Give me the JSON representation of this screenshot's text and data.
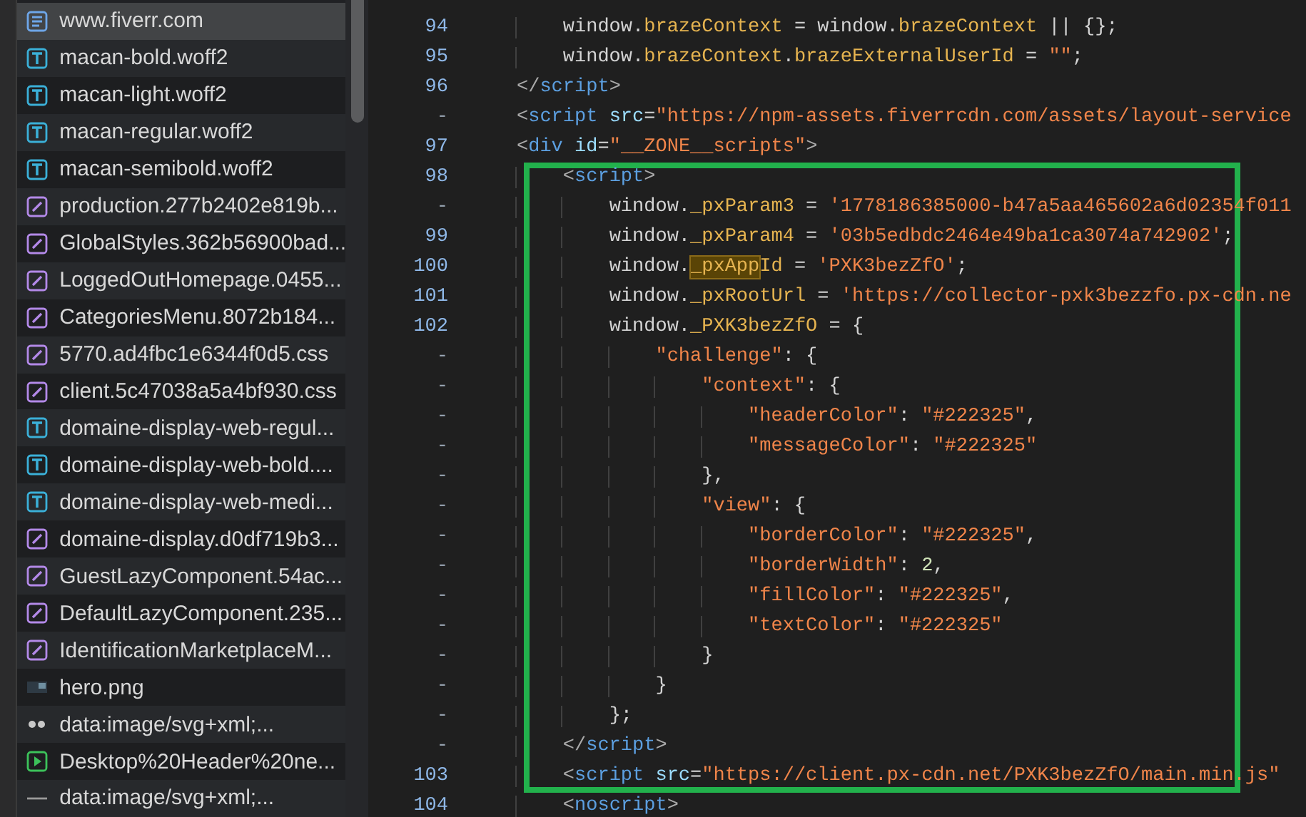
{
  "files": [
    {
      "name": "www.fiverr.com",
      "kind": "document",
      "selected": true
    },
    {
      "name": "macan-bold.woff2",
      "kind": "font",
      "selected": false
    },
    {
      "name": "macan-light.woff2",
      "kind": "font",
      "selected": false
    },
    {
      "name": "macan-regular.woff2",
      "kind": "font",
      "selected": false
    },
    {
      "name": "macan-semibold.woff2",
      "kind": "font",
      "selected": false
    },
    {
      "name": "production.277b2402e819b...",
      "kind": "stylesheet",
      "selected": false
    },
    {
      "name": "GlobalStyles.362b56900bad...",
      "kind": "stylesheet",
      "selected": false
    },
    {
      "name": "LoggedOutHomepage.0455...",
      "kind": "stylesheet",
      "selected": false
    },
    {
      "name": "CategoriesMenu.8072b184...",
      "kind": "stylesheet",
      "selected": false
    },
    {
      "name": "5770.ad4fbc1e6344f0d5.css",
      "kind": "stylesheet",
      "selected": false
    },
    {
      "name": "client.5c47038a5a4bf930.css",
      "kind": "stylesheet",
      "selected": false
    },
    {
      "name": "domaine-display-web-regul...",
      "kind": "font",
      "selected": false
    },
    {
      "name": "domaine-display-web-bold....",
      "kind": "font",
      "selected": false
    },
    {
      "name": "domaine-display-web-medi...",
      "kind": "font",
      "selected": false
    },
    {
      "name": "domaine-display.d0df719b3...",
      "kind": "stylesheet",
      "selected": false
    },
    {
      "name": "GuestLazyComponent.54ac...",
      "kind": "stylesheet",
      "selected": false
    },
    {
      "name": "DefaultLazyComponent.235...",
      "kind": "stylesheet",
      "selected": false
    },
    {
      "name": "IdentificationMarketplaceM...",
      "kind": "stylesheet",
      "selected": false
    },
    {
      "name": "hero.png",
      "kind": "image",
      "selected": false
    },
    {
      "name": "data:image/svg+xml;...",
      "kind": "dots",
      "selected": false
    },
    {
      "name": "Desktop%20Header%20ne...",
      "kind": "media",
      "selected": false
    },
    {
      "name": "data:image/svg+xml;...",
      "kind": "line",
      "selected": false
    }
  ],
  "code_lines": [
    {
      "number": "94",
      "tokens": [
        {
          "text": "    window.",
          "kind": "plain"
        },
        {
          "text": "brazeContext",
          "kind": "prop"
        },
        {
          "text": " = window.",
          "kind": "plain"
        },
        {
          "text": "brazeContext",
          "kind": "prop"
        },
        {
          "text": " || {};",
          "kind": "plain"
        }
      ]
    },
    {
      "number": "95",
      "tokens": [
        {
          "text": "    window.",
          "kind": "plain"
        },
        {
          "text": "brazeContext",
          "kind": "prop"
        },
        {
          "text": ".",
          "kind": "plain"
        },
        {
          "text": "brazeExternalUserId",
          "kind": "prop"
        },
        {
          "text": " = ",
          "kind": "plain"
        },
        {
          "text": "\"\"",
          "kind": "string"
        },
        {
          "text": ";",
          "kind": "plain"
        }
      ]
    },
    {
      "number": "96",
      "tokens": [
        {
          "text": "</",
          "kind": "punct"
        },
        {
          "text": "script",
          "kind": "tag"
        },
        {
          "text": ">",
          "kind": "punct"
        }
      ]
    },
    {
      "number": "-",
      "tokens": [
        {
          "text": "<",
          "kind": "punct"
        },
        {
          "text": "script",
          "kind": "tag"
        },
        {
          "text": " src",
          "kind": "attr"
        },
        {
          "text": "=",
          "kind": "plain"
        },
        {
          "text": "\"https://npm-assets.fiverrcdn.com/assets/layout-service",
          "kind": "string"
        }
      ]
    },
    {
      "number": "97",
      "tokens": [
        {
          "text": "<",
          "kind": "punct"
        },
        {
          "text": "div",
          "kind": "tag"
        },
        {
          "text": " id",
          "kind": "attr"
        },
        {
          "text": "=",
          "kind": "plain"
        },
        {
          "text": "\"__ZONE__scripts\"",
          "kind": "string"
        },
        {
          "text": ">",
          "kind": "punct"
        }
      ]
    },
    {
      "number": "98",
      "tokens": [
        {
          "text": "    <",
          "kind": "punct"
        },
        {
          "text": "script",
          "kind": "tag"
        },
        {
          "text": ">",
          "kind": "punct"
        }
      ]
    },
    {
      "number": "-",
      "tokens": [
        {
          "text": "        window.",
          "kind": "plain"
        },
        {
          "text": "_pxParam3",
          "kind": "prop"
        },
        {
          "text": " = ",
          "kind": "plain"
        },
        {
          "text": "'1778186385000-b47a5aa465602a6d02354f011",
          "kind": "string"
        }
      ]
    },
    {
      "number": "99",
      "tokens": [
        {
          "text": "        window.",
          "kind": "plain"
        },
        {
          "text": "_pxParam4",
          "kind": "prop"
        },
        {
          "text": " = ",
          "kind": "plain"
        },
        {
          "text": "'03b5edbdc2464e49ba1ca3074a742902'",
          "kind": "string"
        },
        {
          "text": ";",
          "kind": "plain"
        }
      ]
    },
    {
      "number": "100",
      "tokens": [
        {
          "text": "        window.",
          "kind": "plain"
        },
        {
          "text": "_pxApp",
          "kind": "match"
        },
        {
          "text": "Id",
          "kind": "prop"
        },
        {
          "text": " = ",
          "kind": "plain"
        },
        {
          "text": "'PXK3bezZfO'",
          "kind": "string"
        },
        {
          "text": ";",
          "kind": "plain"
        }
      ]
    },
    {
      "number": "101",
      "tokens": [
        {
          "text": "        window.",
          "kind": "plain"
        },
        {
          "text": "_pxRootUrl",
          "kind": "prop"
        },
        {
          "text": " = ",
          "kind": "plain"
        },
        {
          "text": "'https://collector-pxk3bezzfo.px-cdn.ne",
          "kind": "string"
        }
      ]
    },
    {
      "number": "102",
      "tokens": [
        {
          "text": "        window.",
          "kind": "plain"
        },
        {
          "text": "_PXK3bezZfO",
          "kind": "prop"
        },
        {
          "text": " = {",
          "kind": "plain"
        }
      ]
    },
    {
      "number": "-",
      "tokens": [
        {
          "text": "            \"challenge\"",
          "kind": "string"
        },
        {
          "text": ": {",
          "kind": "plain"
        }
      ]
    },
    {
      "number": "-",
      "tokens": [
        {
          "text": "                \"context\"",
          "kind": "string"
        },
        {
          "text": ": {",
          "kind": "plain"
        }
      ]
    },
    {
      "number": "-",
      "tokens": [
        {
          "text": "                    \"headerColor\"",
          "kind": "string"
        },
        {
          "text": ": ",
          "kind": "plain"
        },
        {
          "text": "\"#222325\"",
          "kind": "string"
        },
        {
          "text": ",",
          "kind": "plain"
        }
      ]
    },
    {
      "number": "-",
      "tokens": [
        {
          "text": "                    \"messageColor\"",
          "kind": "string"
        },
        {
          "text": ": ",
          "kind": "plain"
        },
        {
          "text": "\"#222325\"",
          "kind": "string"
        }
      ]
    },
    {
      "number": "-",
      "tokens": [
        {
          "text": "                },",
          "kind": "plain"
        }
      ]
    },
    {
      "number": "-",
      "tokens": [
        {
          "text": "                \"view\"",
          "kind": "string"
        },
        {
          "text": ": {",
          "kind": "plain"
        }
      ]
    },
    {
      "number": "-",
      "tokens": [
        {
          "text": "                    \"borderColor\"",
          "kind": "string"
        },
        {
          "text": ": ",
          "kind": "plain"
        },
        {
          "text": "\"#222325\"",
          "kind": "string"
        },
        {
          "text": ",",
          "kind": "plain"
        }
      ]
    },
    {
      "number": "-",
      "tokens": [
        {
          "text": "                    \"borderWidth\"",
          "kind": "string"
        },
        {
          "text": ": ",
          "kind": "plain"
        },
        {
          "text": "2",
          "kind": "number"
        },
        {
          "text": ",",
          "kind": "plain"
        }
      ]
    },
    {
      "number": "-",
      "tokens": [
        {
          "text": "                    \"fillColor\"",
          "kind": "string"
        },
        {
          "text": ": ",
          "kind": "plain"
        },
        {
          "text": "\"#222325\"",
          "kind": "string"
        },
        {
          "text": ",",
          "kind": "plain"
        }
      ]
    },
    {
      "number": "-",
      "tokens": [
        {
          "text": "                    \"textColor\"",
          "kind": "string"
        },
        {
          "text": ": ",
          "kind": "plain"
        },
        {
          "text": "\"#222325\"",
          "kind": "string"
        }
      ]
    },
    {
      "number": "-",
      "tokens": [
        {
          "text": "                }",
          "kind": "plain"
        }
      ]
    },
    {
      "number": "-",
      "tokens": [
        {
          "text": "            }",
          "kind": "plain"
        }
      ]
    },
    {
      "number": "-",
      "tokens": [
        {
          "text": "        };",
          "kind": "plain"
        }
      ]
    },
    {
      "number": "-",
      "tokens": [
        {
          "text": "    </",
          "kind": "punct"
        },
        {
          "text": "script",
          "kind": "tag"
        },
        {
          "text": ">",
          "kind": "punct"
        }
      ]
    },
    {
      "number": "103",
      "tokens": [
        {
          "text": "    <",
          "kind": "punct"
        },
        {
          "text": "script",
          "kind": "tag"
        },
        {
          "text": " src",
          "kind": "attr"
        },
        {
          "text": "=",
          "kind": "plain"
        },
        {
          "text": "\"https://client.px-cdn.net/PXK3bezZfO/main.min.js\"",
          "kind": "string"
        }
      ]
    },
    {
      "number": "104",
      "tokens": [
        {
          "text": "    <",
          "kind": "punct"
        },
        {
          "text": "noscript",
          "kind": "tag"
        },
        {
          "text": ">",
          "kind": "punct"
        }
      ]
    }
  ]
}
